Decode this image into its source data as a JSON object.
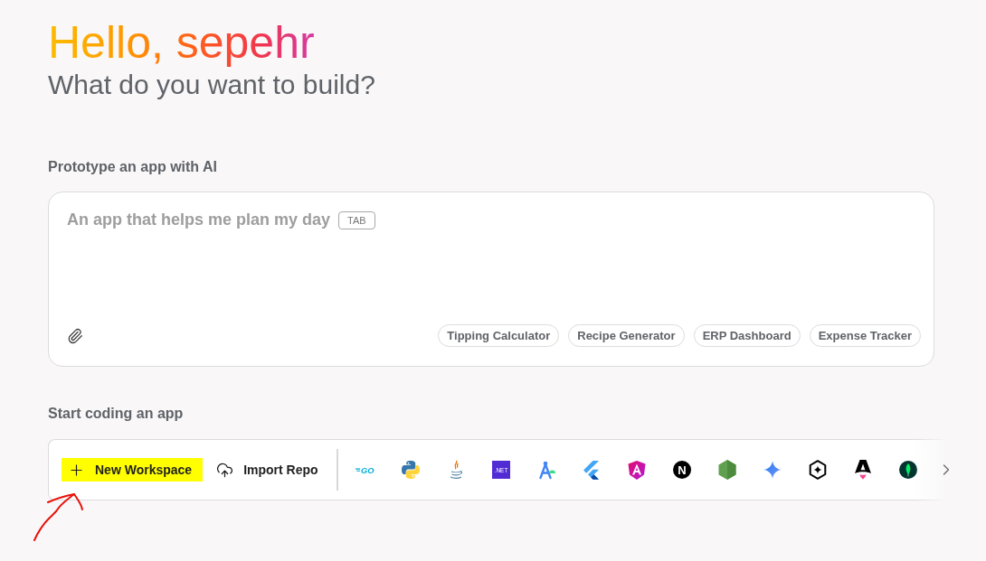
{
  "greeting": {
    "title": "Hello, sepehr",
    "subtitle": "What do you want to build?"
  },
  "prototype": {
    "heading": "Prototype an app with AI",
    "prompt": {
      "placeholder": "An app that helps me plan my day",
      "shortcut": "TAB"
    },
    "suggestions": [
      "Tipping Calculator",
      "Recipe Generator",
      "ERP Dashboard",
      "Expense Tracker"
    ]
  },
  "start_coding": {
    "heading": "Start coding an app",
    "actions": [
      {
        "kind": "new",
        "label": "New Workspace",
        "highlighted": true
      },
      {
        "kind": "import",
        "label": "Import Repo",
        "highlighted": false
      }
    ],
    "templates": [
      {
        "kind": "go",
        "text": "GO"
      },
      {
        "kind": "python"
      },
      {
        "kind": "java"
      },
      {
        "kind": "dotnet",
        "text": ".NET"
      },
      {
        "kind": "compass"
      },
      {
        "kind": "flutter"
      },
      {
        "kind": "angular"
      },
      {
        "kind": "nextjs",
        "text": "N"
      },
      {
        "kind": "nodejs"
      },
      {
        "kind": "gemini"
      },
      {
        "kind": "hexagon"
      },
      {
        "kind": "astro"
      },
      {
        "kind": "mongodb"
      }
    ]
  },
  "annotations": [
    {
      "kind": "arrow"
    }
  ]
}
